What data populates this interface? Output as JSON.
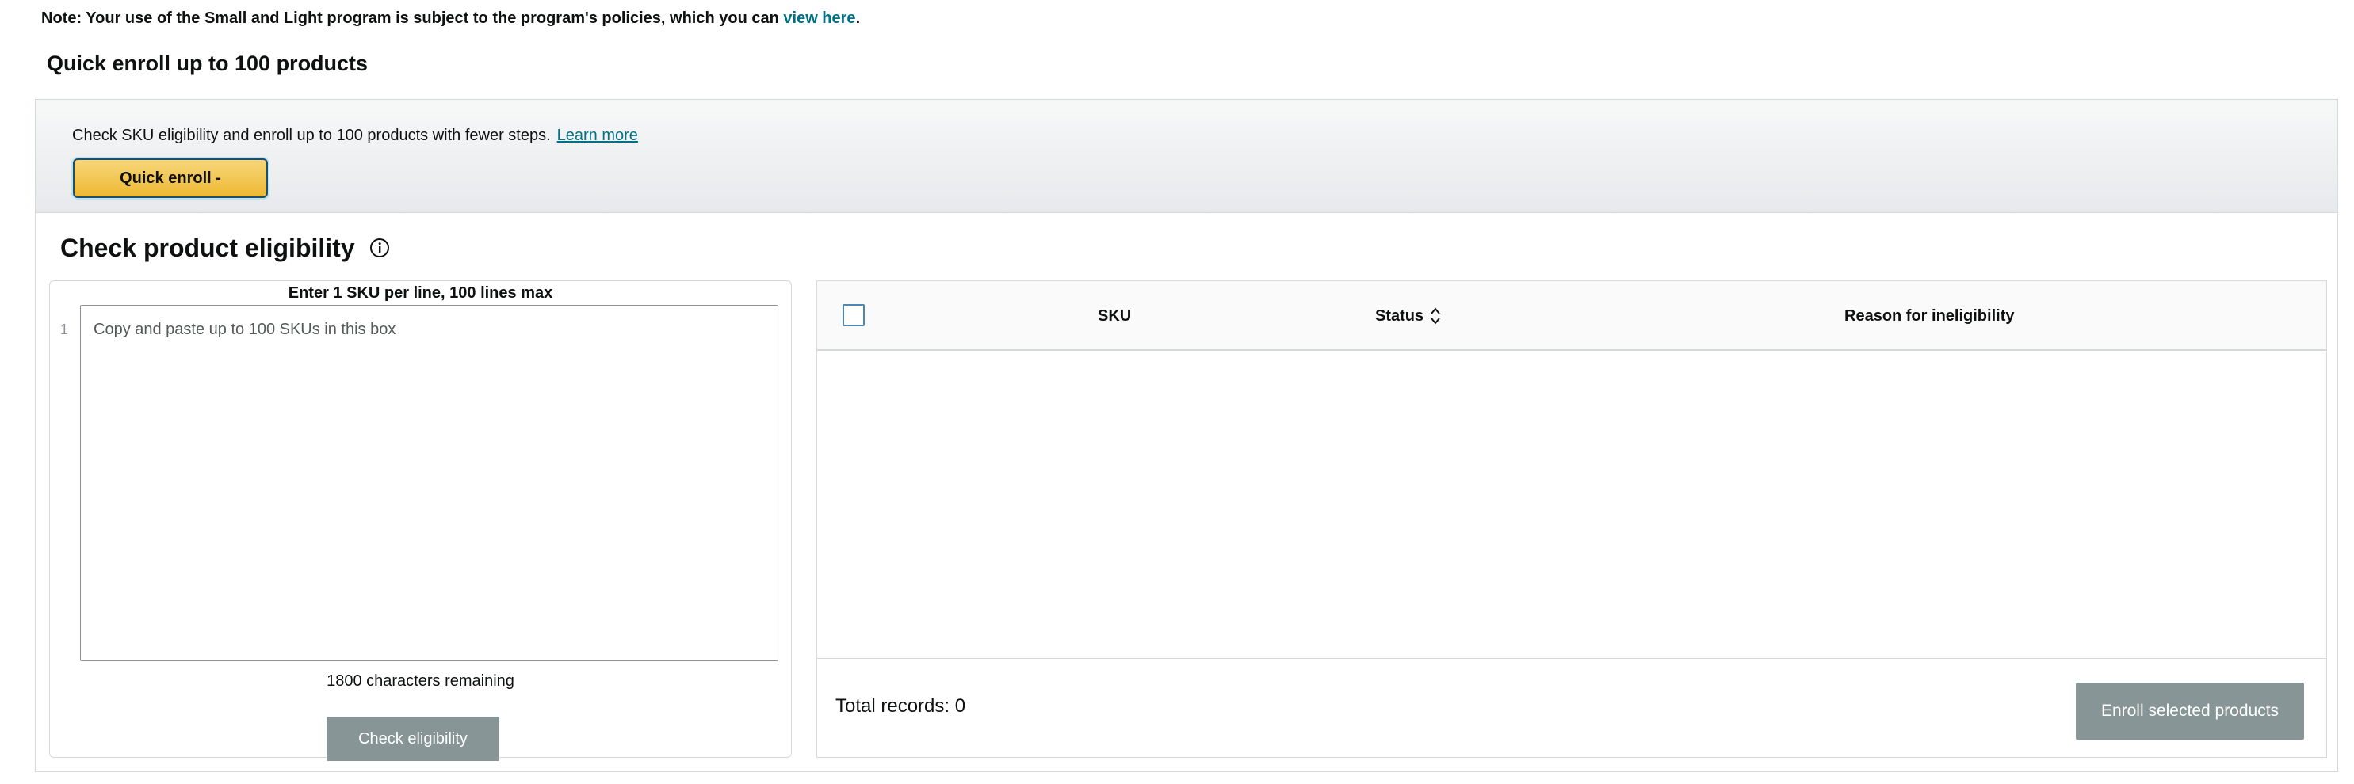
{
  "note": {
    "text": "Note: Your use of the Small and Light program is subject to the program's policies, which you can ",
    "link": "view here",
    "suffix": "."
  },
  "quick_enroll": {
    "title": "Quick enroll up to 100 products",
    "description": "Check SKU eligibility and enroll up to 100 products with fewer steps.",
    "learn_more": "Learn more",
    "button_label": "Quick enroll -"
  },
  "eligibility": {
    "title": "Check product eligibility",
    "info_icon": "info-icon",
    "input_label": "Enter 1 SKU per line, 100 lines max",
    "line_number": "1",
    "placeholder": "Copy and paste up to 100 SKUs in this box",
    "chars_remaining": "1800 characters remaining",
    "check_button": "Check eligibility"
  },
  "results_table": {
    "columns": [
      "SKU",
      "Status",
      "Reason for ineligibility"
    ],
    "rows": [],
    "total_records": "Total records: 0",
    "enroll_button": "Enroll selected products"
  },
  "colors": {
    "link": "#007185",
    "primary_button": "#eeb933",
    "disabled_button": "#879596",
    "checkbox_border": "#4a88b3"
  }
}
